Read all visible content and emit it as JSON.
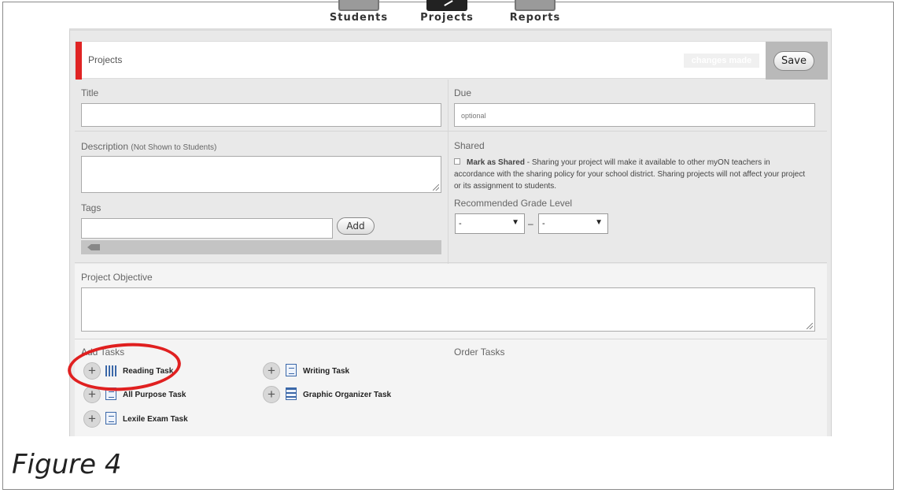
{
  "nav": {
    "items": [
      {
        "label": "Students"
      },
      {
        "label": "Projects"
      },
      {
        "label": "Reports"
      }
    ]
  },
  "header": {
    "title": "Projects",
    "changes_label": "changes made",
    "save_label": "Save"
  },
  "form": {
    "title_label": "Title",
    "due_label": "Due",
    "due_placeholder": "optional",
    "description_label": "Description",
    "description_note": "(Not Shown to Students)",
    "tags_label": "Tags",
    "add_label": "Add",
    "shared_label": "Shared",
    "mark_shared_label": "Mark as Shared",
    "shared_text": " - Sharing your project will make it available to other myON teachers in accordance with the sharing policy for your school district. Sharing projects will not affect your project or its assignment to students.",
    "grade_label": "Recommended Grade Level",
    "grade_from": "-",
    "grade_to": "-",
    "grade_sep": "–",
    "objective_label": "Project Objective"
  },
  "tasks": {
    "add_label": "Add Tasks",
    "order_label": "Order Tasks",
    "items": [
      {
        "label": "Reading Task",
        "icon": "books-icon"
      },
      {
        "label": "Writing Task",
        "icon": "writing-icon"
      },
      {
        "label": "All Purpose Task",
        "icon": "document-icon"
      },
      {
        "label": "Graphic Organizer Task",
        "icon": "organizer-icon"
      },
      {
        "label": "Lexile Exam Task",
        "icon": "exam-icon"
      }
    ]
  },
  "caption": "Figure 4",
  "colors": {
    "accent": "#e02424",
    "annotation": "#e02020",
    "icon": "#3a67a8"
  }
}
